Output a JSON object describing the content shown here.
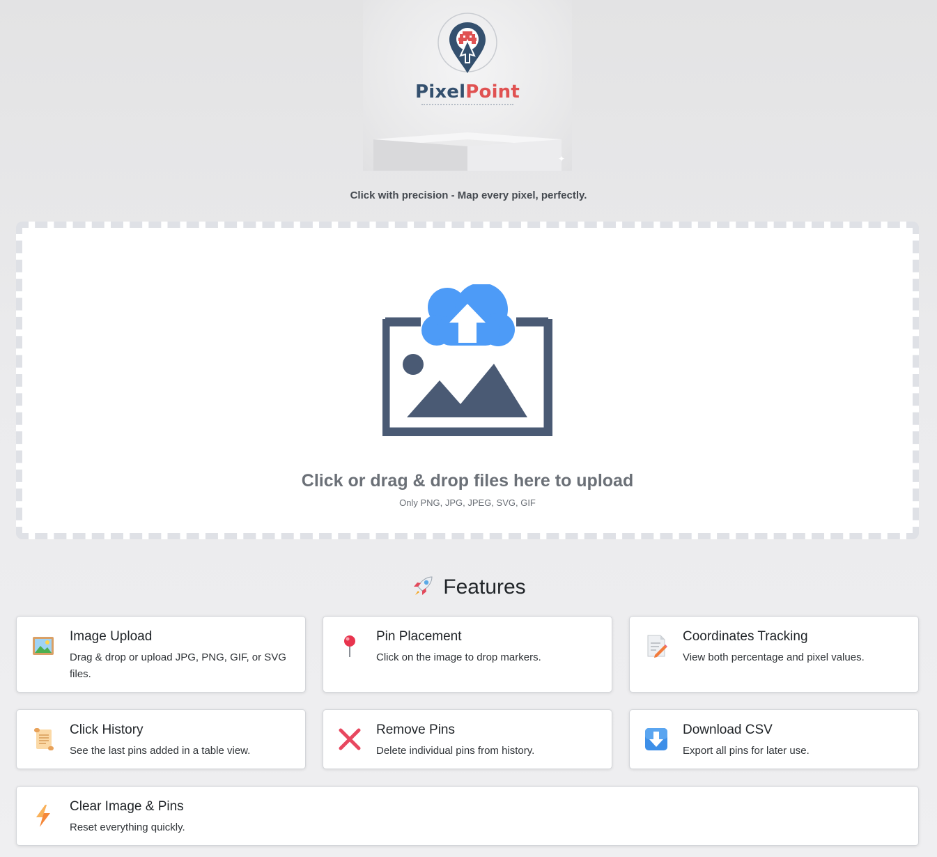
{
  "app": {
    "brand_part1": "Pixel",
    "brand_part2": "Point",
    "tagline": "Click with precision - Map every pixel, perfectly."
  },
  "upload": {
    "title": "Click or drag & drop files here to upload",
    "subtitle": "Only PNG, JPG, JPEG, SVG, GIF",
    "icon": "image-upload-icon"
  },
  "features": {
    "heading": "Features",
    "heading_icon": "rocket-icon",
    "items": [
      {
        "icon": "framed-picture-icon",
        "title": "Image Upload",
        "desc": "Drag & drop or upload JPG, PNG, GIF, or SVG files."
      },
      {
        "icon": "pushpin-icon",
        "title": "Pin Placement",
        "desc": "Click on the image to drop markers."
      },
      {
        "icon": "memo-icon",
        "title": "Coordinates Tracking",
        "desc": "View both percentage and pixel values."
      },
      {
        "icon": "scroll-icon",
        "title": "Click History",
        "desc": "See the last pins added in a table view."
      },
      {
        "icon": "cross-mark-icon",
        "title": "Remove Pins",
        "desc": "Delete individual pins from history."
      },
      {
        "icon": "down-arrow-icon",
        "title": "Download CSV",
        "desc": "Export all pins for later use."
      },
      {
        "icon": "lightning-icon",
        "title": "Clear Image & Pins",
        "desc": "Reset everything quickly."
      }
    ]
  },
  "colors": {
    "brand_dark": "#34506e",
    "brand_red": "#e05252",
    "cloud_blue": "#4d9bf7",
    "illustration_slate": "#4a5a74"
  }
}
